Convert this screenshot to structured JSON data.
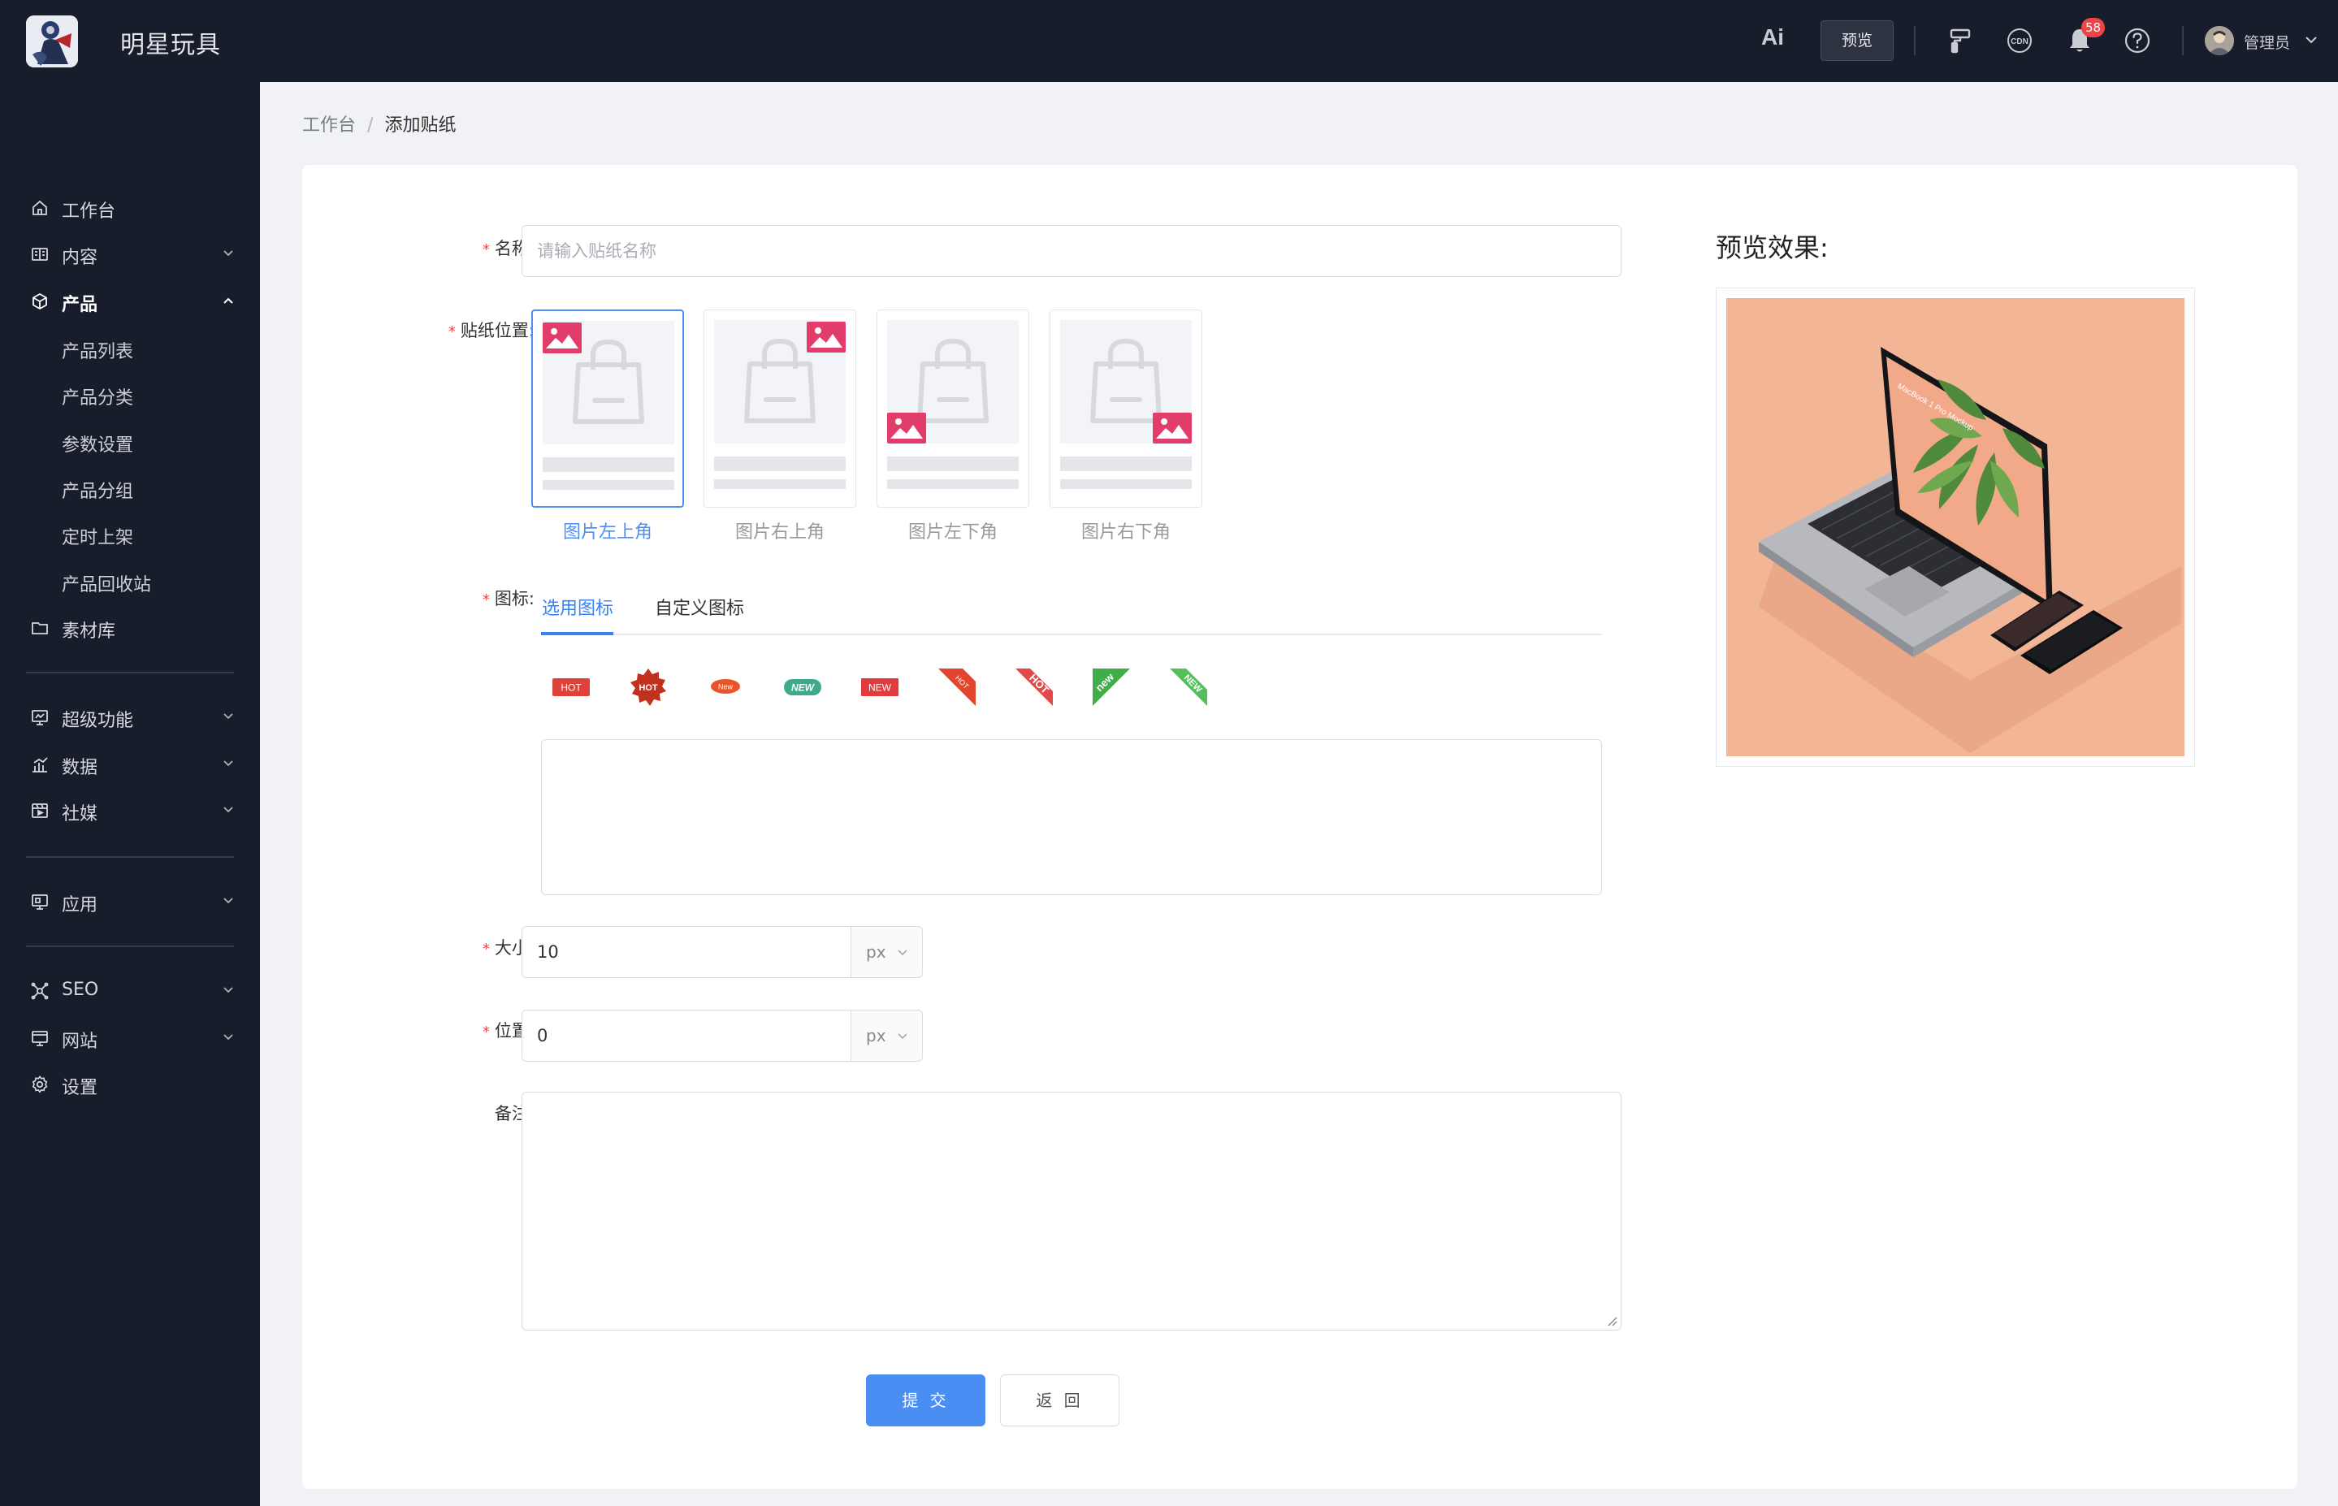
{
  "header": {
    "app_title": "明星玩具",
    "ai_label": "Ai",
    "preview_button": "预览",
    "notification_count": "58",
    "user_name": "管理员"
  },
  "sidebar": {
    "items": [
      {
        "label": "工作台",
        "icon": "home-icon"
      },
      {
        "label": "内容",
        "icon": "content-icon"
      },
      {
        "label": "产品",
        "icon": "cube-icon",
        "expanded": true
      },
      {
        "label": "素材库",
        "icon": "folder-icon"
      },
      {
        "label": "超级功能",
        "icon": "monitor-icon"
      },
      {
        "label": "数据",
        "icon": "chart-icon"
      },
      {
        "label": "社媒",
        "icon": "media-icon"
      },
      {
        "label": "应用",
        "icon": "app-icon"
      },
      {
        "label": "SEO",
        "icon": "seo-icon"
      },
      {
        "label": "网站",
        "icon": "website-icon"
      },
      {
        "label": "设置",
        "icon": "gear-icon"
      }
    ],
    "product_children": [
      "产品列表",
      "产品分类",
      "参数设置",
      "产品分组",
      "定时上架",
      "产品回收站"
    ]
  },
  "breadcrumb": {
    "root": "工作台",
    "separator": "/",
    "current": "添加贴纸"
  },
  "form": {
    "name_label": "名称:",
    "name_placeholder": "请输入贴纸名称",
    "position_label": "贴纸位置:",
    "positions": [
      "图片左上角",
      "图片右上角",
      "图片左下角",
      "图片右下角"
    ],
    "selected_position": "图片左上角",
    "icon_label": "图标:",
    "icon_tabs": [
      "选用图标",
      "自定义图标"
    ],
    "active_icon_tab": "选用图标",
    "stickers": [
      "HOT",
      "HOT",
      "New",
      "NEW",
      "NEW",
      "HOT",
      "HOT",
      "new",
      "NEW"
    ],
    "size_label": "大小:",
    "size_value": "10",
    "size_unit": "px",
    "offset_label": "位置:",
    "offset_value": "0",
    "offset_unit": "px",
    "remark_label": "备注:",
    "submit_button": "提 交",
    "back_button": "返 回"
  },
  "preview": {
    "title": "预览效果:",
    "screen_text": "MacBook 1 Pro Mockup"
  },
  "colors": {
    "header_bg": "#181d2b",
    "accent": "#4a8ef4",
    "badge": "#f04444",
    "required": "#f04646",
    "sticker_mark": "#e23d6a",
    "preview_bg": "#f2b596"
  }
}
